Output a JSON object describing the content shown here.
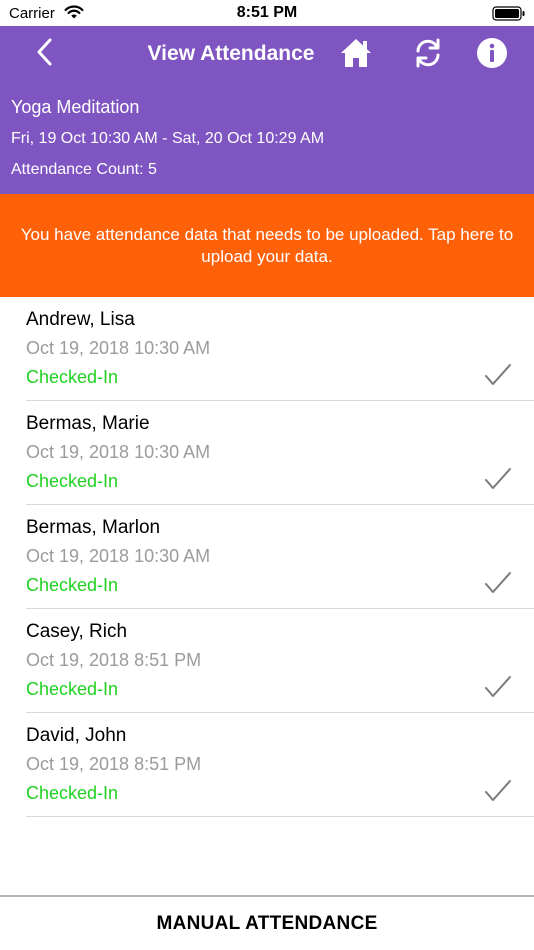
{
  "status_bar": {
    "carrier": "Carrier",
    "time": "8:51 PM"
  },
  "nav": {
    "title": "View Attendance",
    "icons": [
      "back-icon",
      "home-icon",
      "refresh-icon",
      "info-icon"
    ]
  },
  "event": {
    "name": "Yoga Meditation",
    "dates": "Fri, 19 Oct 10:30 AM - Sat, 20 Oct 10:29 AM",
    "count": "Attendance Count: 5"
  },
  "banner": {
    "message": "You have attendance data that needs to be uploaded. Tap here to upload your data."
  },
  "attendees": [
    {
      "name": "Andrew, Lisa",
      "time": "Oct 19, 2018 10:30 AM",
      "status": "Checked-In"
    },
    {
      "name": "Bermas, Marie",
      "time": "Oct 19, 2018 10:30 AM",
      "status": "Checked-In"
    },
    {
      "name": "Bermas, Marlon",
      "time": "Oct 19, 2018 10:30 AM",
      "status": "Checked-In"
    },
    {
      "name": "Casey, Rich",
      "time": "Oct 19, 2018 8:51 PM",
      "status": "Checked-In"
    },
    {
      "name": "David, John",
      "time": "Oct 19, 2018 8:51 PM",
      "status": "Checked-In"
    }
  ],
  "footer": {
    "manual_label": "MANUAL ATTENDANCE"
  },
  "colors": {
    "header": "#7f55c2",
    "banner": "#ff6109",
    "checked_in": "#1fd21f",
    "muted": "#9b9b9b"
  }
}
